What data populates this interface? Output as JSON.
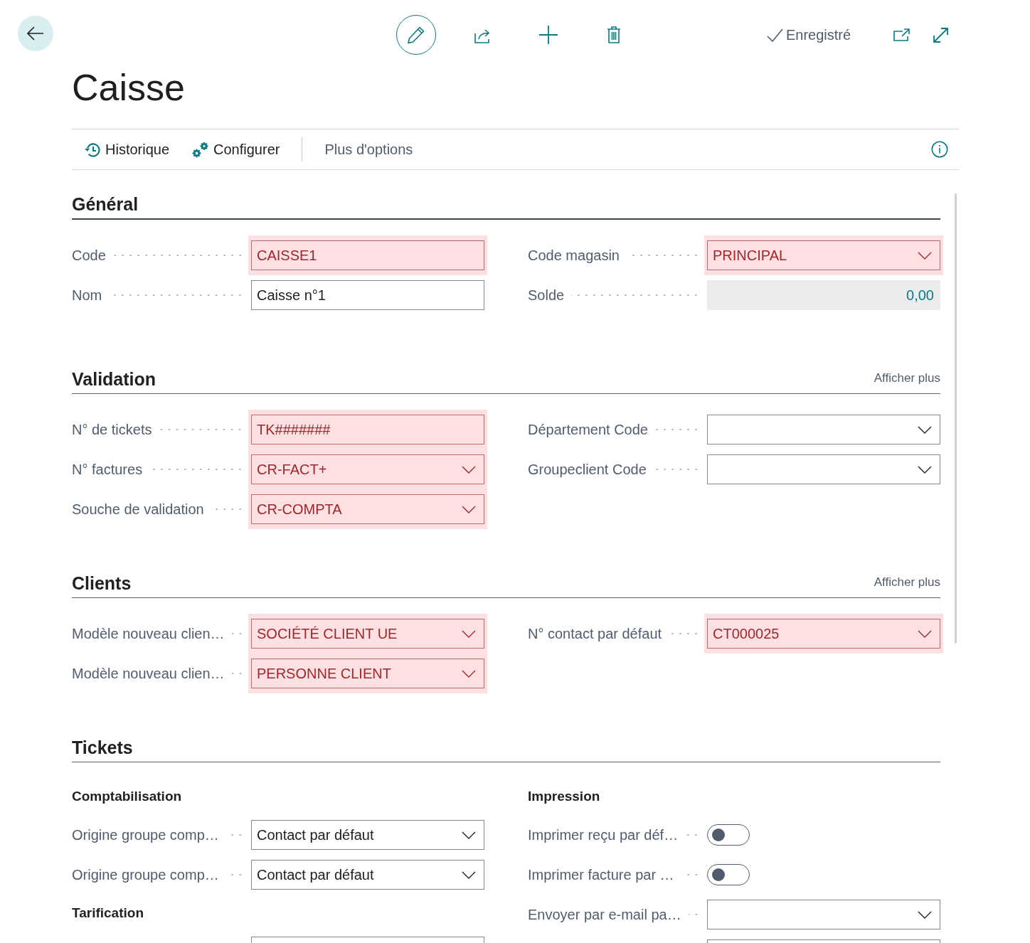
{
  "topbar": {
    "status": "Enregistré"
  },
  "title": "Caisse",
  "action_bar": {
    "actions": [
      "Historique",
      "Configurer"
    ],
    "more": "Plus d'options"
  },
  "sections": [
    {
      "title": "Général",
      "focused": true,
      "columns": [
        {
          "items": [
            {
              "kind": "text",
              "label": "Code",
              "value": "CAISSE1",
              "error": true
            },
            {
              "kind": "text",
              "label": "Nom",
              "value": "Caisse n°1",
              "error": false
            }
          ]
        },
        {
          "items": [
            {
              "kind": "dropdown",
              "label": "Code magasin",
              "value": "PRINCIPAL",
              "error": true
            },
            {
              "kind": "readonly",
              "label": "Solde",
              "value": "0,00"
            }
          ]
        }
      ]
    },
    {
      "title": "Validation",
      "focused": false,
      "show_more": "Afficher plus",
      "columns": [
        {
          "items": [
            {
              "kind": "text",
              "label": "N° de tickets",
              "value": "TK#######",
              "error": true
            },
            {
              "kind": "dropdown",
              "label": "N° factures",
              "value": "CR-FACT+",
              "error": true
            },
            {
              "kind": "dropdown",
              "label": "Souche de validation",
              "value": "CR-COMPTA",
              "error": true
            }
          ]
        },
        {
          "items": [
            {
              "kind": "dropdown",
              "label": "Département Code",
              "error": false
            },
            {
              "kind": "dropdown",
              "label": "Groupeclient Code",
              "error": false
            }
          ]
        }
      ]
    },
    {
      "title": "Clients",
      "focused": false,
      "show_more": "Afficher plus",
      "columns": [
        {
          "items": [
            {
              "kind": "dropdown",
              "label": "Modèle nouveau clien…",
              "value": "SOCIÉTÉ CLIENT UE",
              "error": true
            },
            {
              "kind": "dropdown",
              "label": "Modèle nouveau clien…",
              "value": "PERSONNE CLIENT",
              "error": true
            }
          ]
        },
        {
          "items": [
            {
              "kind": "dropdown",
              "label": "N° contact par défaut",
              "value": "CT000025",
              "error": true
            }
          ]
        }
      ]
    },
    {
      "title": "Tickets",
      "focused": false,
      "columns": [
        {
          "items": [
            {
              "kind": "group",
              "label": "Comptabilisation"
            },
            {
              "kind": "dropdown",
              "label": "Origine groupe comp…",
              "value": "Contact par défaut",
              "error": false
            },
            {
              "kind": "dropdown",
              "label": "Origine groupe comp…",
              "value": "Contact par défaut",
              "error": false
            },
            {
              "kind": "group",
              "label": "Tarification"
            },
            {
              "kind": "text",
              "error": false
            }
          ]
        },
        {
          "items": [
            {
              "kind": "group",
              "label": "Impression"
            },
            {
              "kind": "toggle",
              "label": "Imprimer reçu par déf…",
              "on": false
            },
            {
              "kind": "toggle",
              "label": "Imprimer facture par …",
              "on": false
            },
            {
              "kind": "dropdown",
              "label": "Envoyer par e-mail pa…",
              "error": false
            },
            {
              "kind": "text",
              "error": false
            }
          ]
        }
      ]
    }
  ]
}
